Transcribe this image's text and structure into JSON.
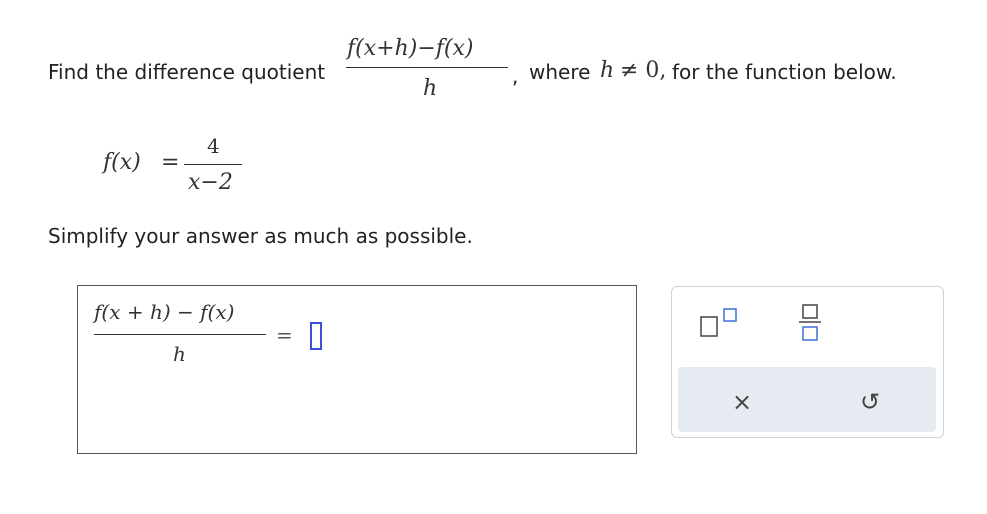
{
  "prompt": {
    "intro": "Find the difference quotient",
    "comma": ",",
    "where": "where",
    "condition_var": "h",
    "condition_rest": "≠ 0,",
    "tail": "for the function below.",
    "quotient_numerator": "f(x+h)−f(x)",
    "quotient_denominator": "h"
  },
  "function_def": {
    "lhs": "f(x)",
    "equals": "=",
    "numerator": "4",
    "denominator": "x−2"
  },
  "instruction": "Simplify your answer as much as possible.",
  "answer": {
    "lhs_numerator": "f(x + h) − f(x)",
    "lhs_denominator": "h",
    "equals": "=",
    "value": ""
  },
  "keypad": {
    "exponent_key": "superscript-template",
    "fraction_key": "fraction-template",
    "clear_label": "×",
    "undo_label": "↺",
    "accent_color": "#3d4fd6",
    "bar_color": "#e5ebf1"
  }
}
